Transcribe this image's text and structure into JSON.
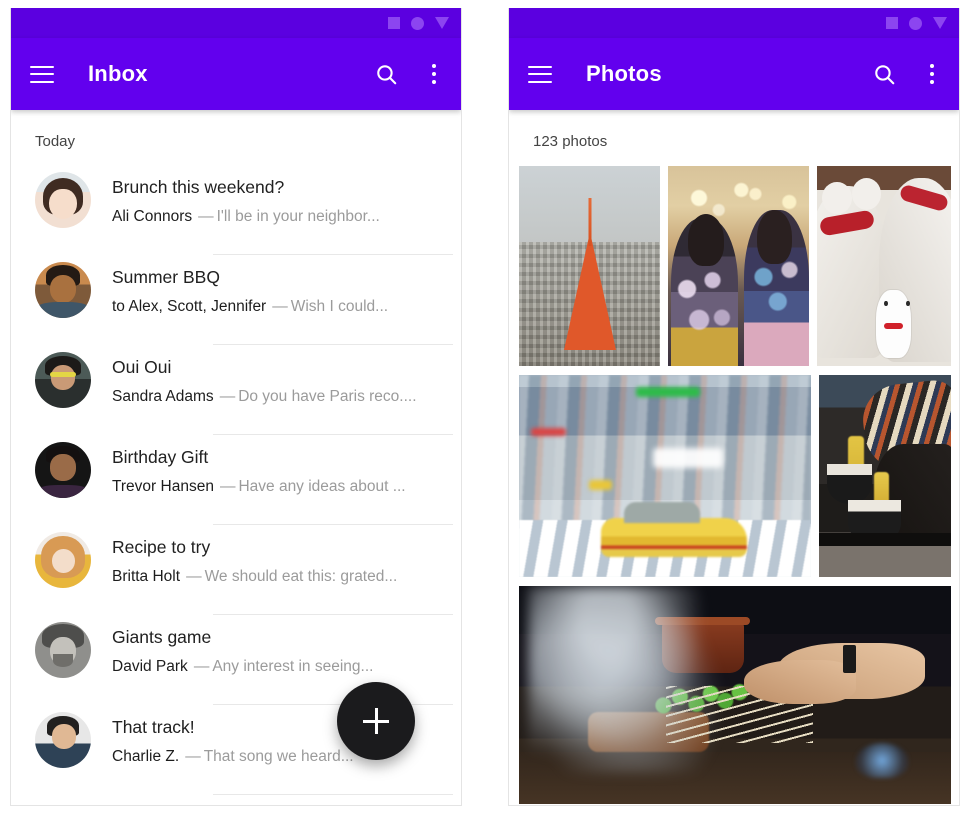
{
  "inbox_panel": {
    "statusbar": {
      "icons": [
        "square-icon",
        "circle-icon",
        "triangle-icon"
      ]
    },
    "appbar": {
      "menu_icon": "hamburger-menu-icon",
      "title": "Inbox",
      "search_icon": "search-icon",
      "more_icon": "more-vertical-icon"
    },
    "section_label": "Today",
    "fab": {
      "icon": "plus-icon",
      "color": "#1b1b1d"
    },
    "messages": [
      {
        "subject": "Brunch this weekend?",
        "sender": "Ali Connors",
        "dash": "—",
        "preview": "I'll be in your neighbor..."
      },
      {
        "subject": "Summer BBQ",
        "sender": "to Alex, Scott, Jennifer",
        "dash": "—",
        "preview": "Wish I could..."
      },
      {
        "subject": "Oui Oui",
        "sender": "Sandra Adams",
        "dash": "—",
        "preview": "Do you have Paris reco...."
      },
      {
        "subject": "Birthday Gift",
        "sender": "Trevor Hansen",
        "dash": "—",
        "preview": "Have any ideas about ..."
      },
      {
        "subject": "Recipe to try",
        "sender": "Britta Holt",
        "dash": "—",
        "preview": "We should eat this: grated..."
      },
      {
        "subject": "Giants game",
        "sender": "David Park",
        "dash": "—",
        "preview": "Any interest in seeing..."
      },
      {
        "subject": "That track!",
        "sender": "Charlie Z.",
        "dash": "—",
        "preview": "That song we heard..."
      }
    ]
  },
  "photos_panel": {
    "statusbar": {
      "icons": [
        "square-icon",
        "circle-icon",
        "triangle-icon"
      ]
    },
    "appbar": {
      "menu_icon": "hamburger-menu-icon",
      "title": "Photos",
      "search_icon": "search-icon",
      "more_icon": "more-vertical-icon"
    },
    "count_label": "123 photos",
    "photos": [
      {
        "alt": "Tokyo Tower over city skyline"
      },
      {
        "alt": "Two women in floral kimonos at a festival"
      },
      {
        "alt": "White cat statues with red collars and a maneki-neko"
      },
      {
        "alt": "Motion-blurred yellow taxi crossing a neon street"
      },
      {
        "alt": "Person in striped scarf eating noodles from a bowl"
      },
      {
        "alt": "Hands grilling yakitori skewers over smoky coals"
      }
    ]
  },
  "theme": {
    "primary": "#6200ee",
    "statusbar": "#5b00e0",
    "statusbar_icon": "#8c45f0",
    "on_primary": "#ffffff",
    "surface": "#ffffff",
    "text_primary": "#212121",
    "text_secondary": "#9b9b9b",
    "divider": "#e8e8e8"
  }
}
